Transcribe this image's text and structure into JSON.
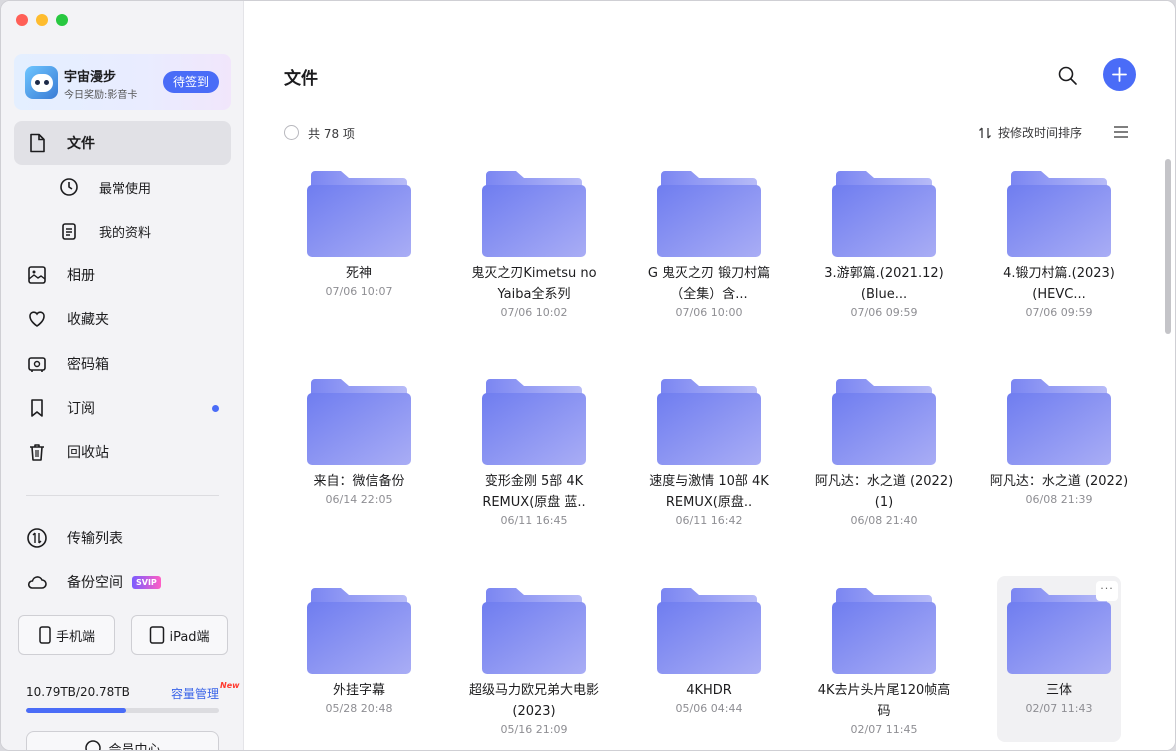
{
  "sidebar": {
    "promo": {
      "title": "宇宙漫步",
      "subtitle": "今日奖励:影音卡",
      "button": "待签到"
    },
    "items": [
      {
        "label": "文件",
        "icon": "file-icon",
        "active": true
      },
      {
        "label": "最常使用",
        "icon": "clock-icon",
        "sub": true
      },
      {
        "label": "我的资料",
        "icon": "documents-icon",
        "sub": true
      },
      {
        "label": "相册",
        "icon": "photo-icon"
      },
      {
        "label": "收藏夹",
        "icon": "heart-icon"
      },
      {
        "label": "密码箱",
        "icon": "safe-icon"
      },
      {
        "label": "订阅",
        "icon": "bookmark-icon",
        "dot": true
      },
      {
        "label": "回收站",
        "icon": "trash-icon"
      }
    ],
    "transfer": "传输列表",
    "backup": "备份空间",
    "backup_badge": "SVIP",
    "phone_btn": "手机端",
    "ipad_btn": "iPad端",
    "storage": {
      "text": "10.79TB/20.78TB",
      "link": "容量管理",
      "new": "New",
      "used_fraction": 0.519
    },
    "member": "会员中心"
  },
  "main": {
    "title": "文件",
    "count": "共 78 项",
    "sort": "按修改时间排序",
    "folders": [
      {
        "name": "死神",
        "date": "07/06 10:07"
      },
      {
        "name": "鬼灭之刃Kimetsu no Yaiba全系列",
        "date": "07/06 10:02"
      },
      {
        "name": "G 鬼灭之刃 锻刀村篇（全集）含...",
        "date": "07/06 10:00"
      },
      {
        "name": "3.游郭篇.(2021.12)(Blue...",
        "date": "07/06 09:59"
      },
      {
        "name": "4.锻刀村篇.(2023)(HEVC...",
        "date": "07/06 09:59"
      },
      {
        "name": "来自：微信备份",
        "date": "06/14 22:05"
      },
      {
        "name": "变形金刚 5部 4K REMUX(原盘 蓝..",
        "date": "06/11 16:45"
      },
      {
        "name": "速度与激情 10部 4K REMUX(原盘..",
        "date": "06/11 16:42"
      },
      {
        "name": "阿凡达：水之道 (2022)(1)",
        "date": "06/08 21:40"
      },
      {
        "name": "阿凡达：水之道 (2022)",
        "date": "06/08 21:39"
      },
      {
        "name": "外挂字幕",
        "date": "05/28 20:48"
      },
      {
        "name": "超级马力欧兄弟大电影 (2023)",
        "date": "05/16 21:09"
      },
      {
        "name": "4KHDR",
        "date": "05/06 04:44"
      },
      {
        "name": "4K去片头片尾120帧高码",
        "date": "02/07 11:45"
      },
      {
        "name": "三体",
        "date": "02/07 11:43"
      }
    ],
    "more_label": "···"
  }
}
